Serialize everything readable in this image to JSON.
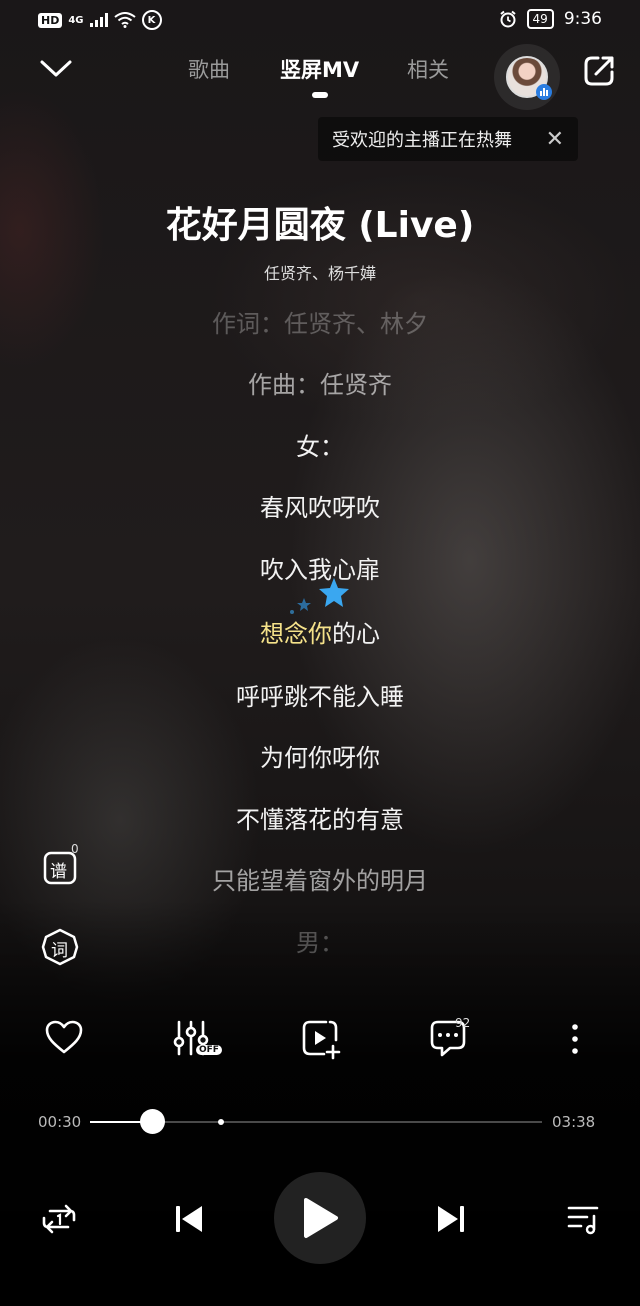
{
  "status_bar": {
    "network_badge": "HD",
    "network_type": "4G",
    "battery": "49",
    "time": "9:36",
    "k_icon": "K"
  },
  "nav": {
    "tabs": [
      {
        "label": "歌曲",
        "active": false
      },
      {
        "label": "竖屏MV",
        "active": true
      },
      {
        "label": "相关",
        "active": false
      }
    ]
  },
  "promo": {
    "text": "受欢迎的主播正在热舞"
  },
  "song": {
    "title": "花好月圆夜 (Live)",
    "artists": "任贤齐、杨千嬅"
  },
  "lyrics": [
    {
      "text": "作词：任贤齐、林夕",
      "state": "faded"
    },
    {
      "text": "作曲：任贤齐",
      "state": "dim"
    },
    {
      "text": "女：",
      "state": "normal"
    },
    {
      "text": "春风吹呀吹",
      "state": "normal"
    },
    {
      "text": "吹入我心扉",
      "state": "normal"
    },
    {
      "text_sung": "想念你",
      "text_rest": "的心",
      "state": "current"
    },
    {
      "text": "呼呼跳不能入睡",
      "state": "normal"
    },
    {
      "text": "为何你呀你",
      "state": "normal"
    },
    {
      "text": "不懂落花的有意",
      "state": "normal"
    },
    {
      "text": "只能望着窗外的明月",
      "state": "dim"
    },
    {
      "text": "男：",
      "state": "faded"
    }
  ],
  "side_buttons": {
    "sheet_label": "谱",
    "sheet_count": "0",
    "lyric_label": "词"
  },
  "actions": {
    "effect_badge": "OFF",
    "comment_count": "92"
  },
  "progress": {
    "elapsed": "00:30",
    "total": "03:38",
    "played_fraction": 0.138
  },
  "colors": {
    "highlight": "#f5e28a",
    "accent_blue": "#2a7de1",
    "star": "#3aa7f0"
  }
}
